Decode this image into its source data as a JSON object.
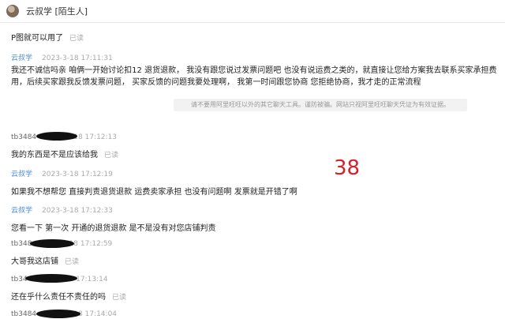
{
  "header": {
    "title": "云叔学 [陌生人]"
  },
  "read_label": "已读",
  "notice_text": "请不要用阿里旺旺以外的其它聊天工具。谨防被骗。网站只视阿里旺旺聊天凭证为有效证据。",
  "overlay_number": "38",
  "messages": [
    {
      "sender": "",
      "time": "",
      "text": "P图就可以用了",
      "read": true
    },
    {
      "sender": "云叔学",
      "time": "2023-3-18 17:11:31",
      "text": "我还不诚信吗亲  咱俩一开始讨论扣12 退货退款， 我没有跟您说过发票问题吧 也没有说运费之类的，就直接让您给方案我去联系买家承担费用，后续买家跟我反馈发票问题， 买家反馈的问题我要处理啊， 我第一时间跟您协商 您拒绝协商，我才走的正常流程",
      "read": false
    },
    {
      "sender": "tb3484",
      "time": "2023-3-18 17:12:13",
      "text": "我的东西是不是应该给我",
      "read": true
    },
    {
      "sender": "云叔学",
      "time": "2023-3-18 17:12:19",
      "text": "如果我不想帮您  直接判责退货退款 运费卖家承担  也没有问题啊 发票就是开错了啊",
      "read": false
    },
    {
      "sender": "云叔学",
      "time": "2023-3-18 17:12:33",
      "text": "您看一下 第一次 开通的退货退款 是不是没有对您店铺判责",
      "read": false
    },
    {
      "sender": "tb348",
      "time": "2023-3-18 17:12:59",
      "text": "大哥我这店铺",
      "read": true
    },
    {
      "sender": "tb34",
      "time": "2023-3-18 17:13:14",
      "text": "还在乎什么责任不责任的吗",
      "read": true
    },
    {
      "sender": "tb3484",
      "time": "2023-3-18 17:14:04",
      "text": "",
      "read": false
    }
  ]
}
